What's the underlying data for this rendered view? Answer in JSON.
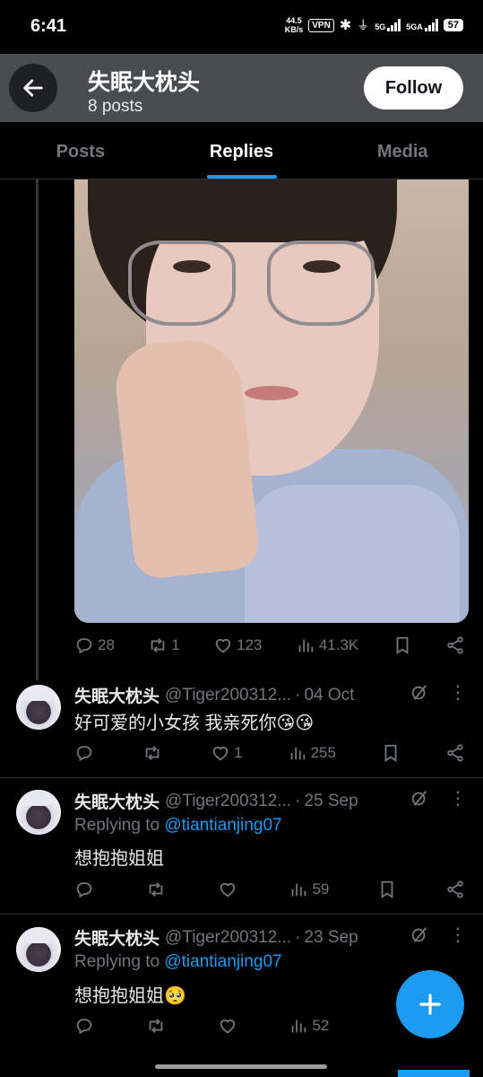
{
  "status_bar": {
    "time": "6:41",
    "net_speed_value": "44.5",
    "net_speed_unit": "KB/s",
    "vpn": "VPN",
    "sim1": "5G",
    "sim2": "5GA",
    "battery": "57"
  },
  "header": {
    "title": "失眠大枕头",
    "subtitle": "8 posts",
    "follow_label": "Follow"
  },
  "tabs": [
    {
      "label": "Posts"
    },
    {
      "label": "Replies"
    },
    {
      "label": "Media"
    }
  ],
  "first_post": {
    "replies": "28",
    "reposts": "1",
    "likes": "123",
    "views": "41.3K"
  },
  "tweets": [
    {
      "name": "失眠大枕头",
      "handle": "@Tiger200312...",
      "date": "04 Oct",
      "replying_prefix": "",
      "replying_to": "",
      "text": "好可爱的小女孩 我亲死你😘😘",
      "replies": "",
      "reposts": "",
      "likes": "1",
      "views": "255"
    },
    {
      "name": "失眠大枕头",
      "handle": "@Tiger200312...",
      "date": "25 Sep",
      "replying_prefix": "Replying to ",
      "replying_to": "@tiantianjing07",
      "text": "想抱抱姐姐",
      "replies": "",
      "reposts": "",
      "likes": "",
      "views": "59"
    },
    {
      "name": "失眠大枕头",
      "handle": "@Tiger200312...",
      "date": "23 Sep",
      "replying_prefix": "Replying to ",
      "replying_to": "@tiantianjing07",
      "text": "想抱抱姐姐🥺",
      "replies": "",
      "reposts": "",
      "likes": "",
      "views": "52"
    }
  ],
  "dot_separator": "·",
  "colors": {
    "accent": "#1d9bf0",
    "background": "#000000",
    "muted": "#71767b",
    "header_bg": "#4a4d50"
  }
}
